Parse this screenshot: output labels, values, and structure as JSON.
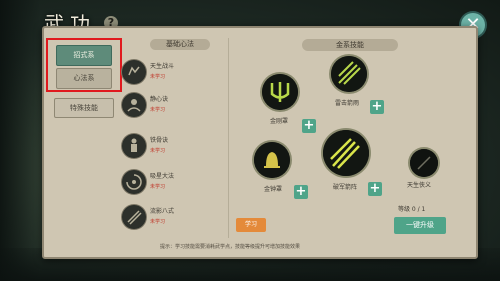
{
  "window": {
    "title": "武功",
    "help_icon": "?",
    "close_icon": "✕"
  },
  "tabs": [
    {
      "label": "招式系"
    },
    {
      "label": "心法系"
    },
    {
      "label": "特殊技能"
    }
  ],
  "list": {
    "header": "基础心法",
    "items": [
      {
        "name": "天生战斗",
        "status": "未学习"
      },
      {
        "name": "静心诀",
        "status": "未学习"
      },
      {
        "name": "铁骨诀",
        "status": "未学习"
      },
      {
        "name": "吸星大法",
        "status": "未学习"
      },
      {
        "name": "流影八式",
        "status": "未学习"
      }
    ]
  },
  "tree": {
    "header": "金系技能",
    "skills": [
      {
        "name": "金刚罩",
        "icon": "trident-icon"
      },
      {
        "name": "雷击箭雨",
        "icon": "arrows-icon"
      },
      {
        "name": "金钟罩",
        "icon": "bell-icon"
      },
      {
        "name": "破军箭阵",
        "icon": "spear-rain-icon"
      },
      {
        "name": "天生侠义",
        "icon": "dark-orb-icon"
      }
    ],
    "level_note": "等级 0 / 1"
  },
  "buttons": {
    "learn": "学习",
    "upgrade": "一键升级"
  },
  "footer": "提示：学习技能需要消耗武学点，技能等级提升可增加技能效果",
  "colors": {
    "accent_green": "#4fa489",
    "highlight_red": "#e0191e",
    "learn_orange": "#e48a3a"
  }
}
